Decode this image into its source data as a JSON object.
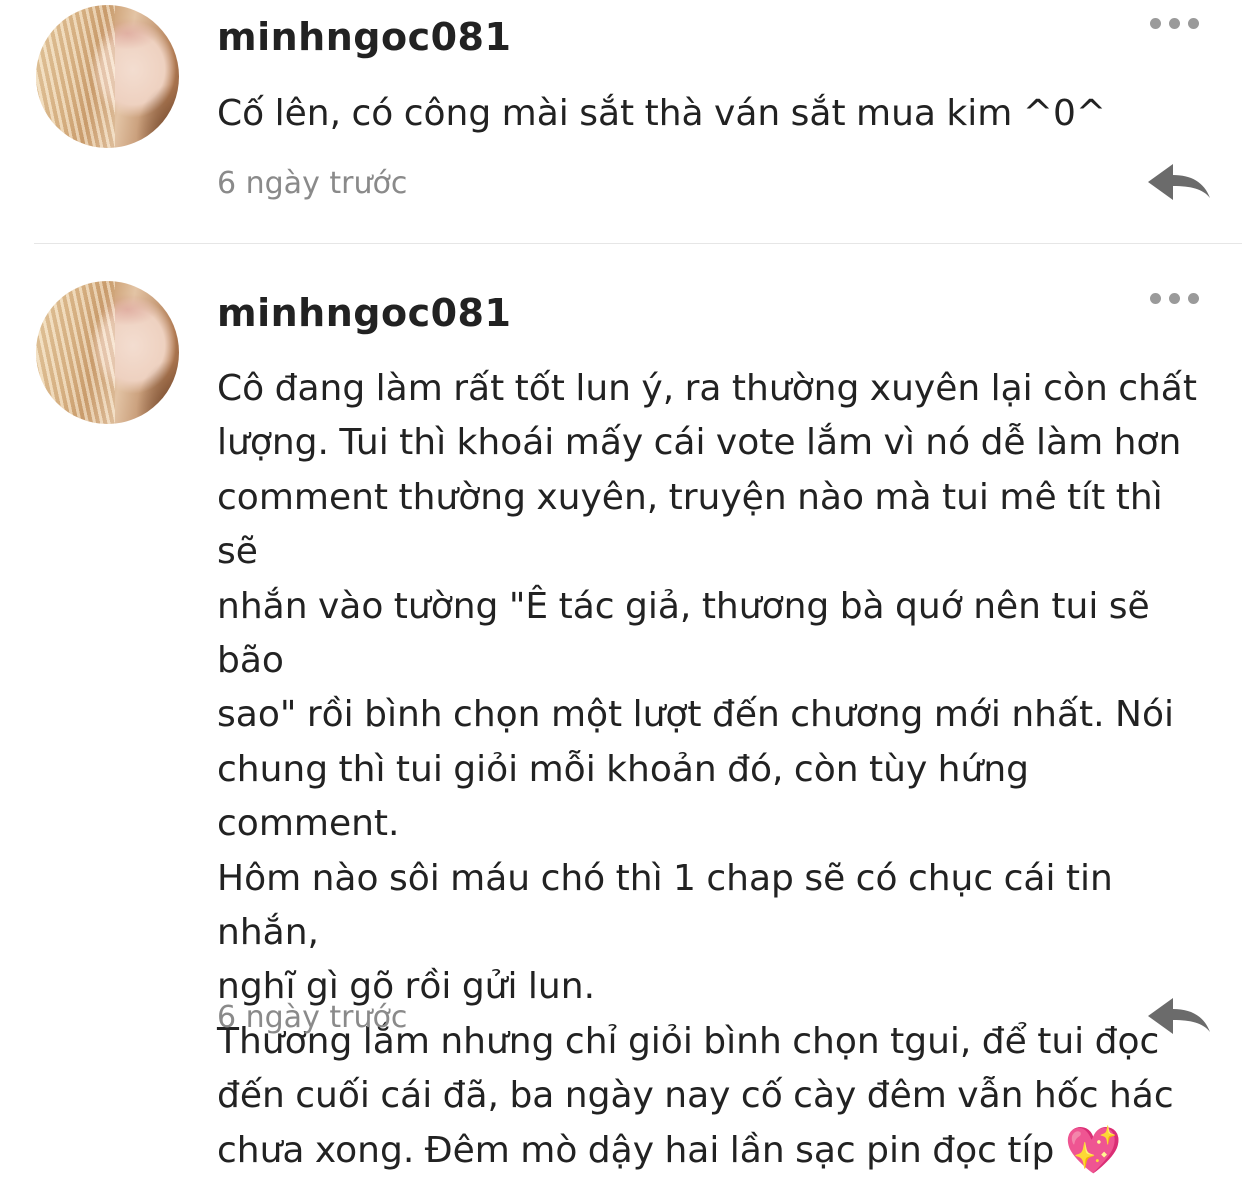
{
  "comments": [
    {
      "username": "minhngoc081",
      "text": "Cố lên, có công mài sắt thà ván sắt mua kim ^0^",
      "time": "6 ngày trước"
    },
    {
      "username": "minhngoc081",
      "text": "Cô đang làm rất tốt lun ý, ra thường xuyên lại còn chất\nlượng. Tui thì khoái mấy cái vote lắm vì nó dễ làm hơn\ncomment thường xuyên, truyện nào mà tui mê tít thì sẽ\nnhắn vào tường \"Ê tác giả, thương bà quớ nên tui sẽ bão\nsao\" rồi bình chọn một lượt đến chương mới nhất. Nói\nchung thì tui giỏi mỗi khoản đó, còn tùy hứng comment.\nHôm nào sôi máu chó thì 1 chap sẽ có chục cái tin nhắn,\nnghĩ gì gõ rồi gửi lun.\nThương lắm nhưng chỉ giỏi bình chọn tgui, để tui đọc\nđến cuối cái đã, ba ngày nay cố cày đêm vẫn hốc hác\nchưa xong. Đêm mò dậy hai lần sạc pin đọc típ ",
      "emoji": "💖",
      "time": "6 ngày trước"
    }
  ],
  "icons": {
    "avatar": "avatar-photo",
    "more": "more-options-icon",
    "reply": "reply-arrow-icon"
  },
  "colors": {
    "text": "#222222",
    "timestamp": "#8a8a8a",
    "icon": "#6b6b6b",
    "divider": "#e6e6e6"
  }
}
